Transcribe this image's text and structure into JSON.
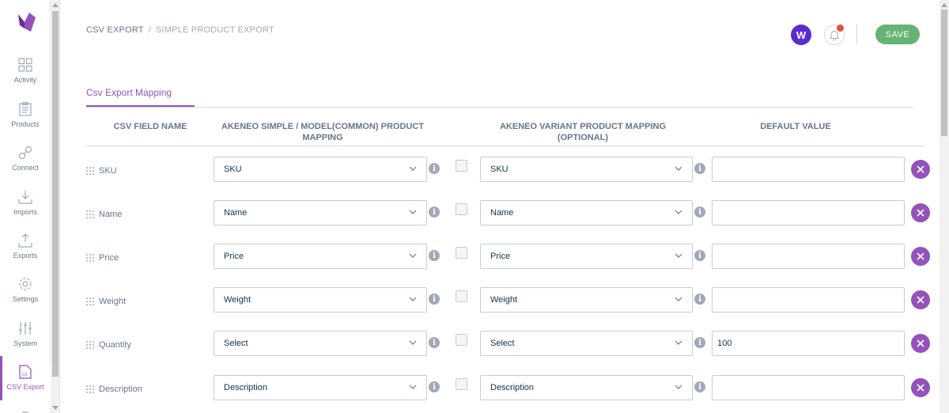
{
  "nav": {
    "items": [
      {
        "label": "Activity",
        "icon": "dashboard-grid-icon"
      },
      {
        "label": "Products",
        "icon": "clipboard-icon"
      },
      {
        "label": "Connect",
        "icon": "connect-icon"
      },
      {
        "label": "Imports",
        "icon": "import-icon"
      },
      {
        "label": "Exports",
        "icon": "export-icon"
      },
      {
        "label": "Settings",
        "icon": "gear-icon"
      },
      {
        "label": "System",
        "icon": "sliders-icon"
      },
      {
        "label": "CSV Export",
        "icon": "csv-file-icon"
      }
    ],
    "active": "CSV Export",
    "accent": "#9452ba"
  },
  "header": {
    "breadcrumb": {
      "root": "CSV EXPORT",
      "separator": "/",
      "current": "SIMPLE PRODUCT EXPORT"
    },
    "avatar_letter": "W",
    "save_label": "SAVE",
    "save_color": "#67b373"
  },
  "tabs": [
    {
      "label": "Csv Export Mapping",
      "active": true
    }
  ],
  "table": {
    "headers": {
      "field": "CSV FIELD NAME",
      "simple": "AKENEO SIMPLE / MODEL(COMMON) PRODUCT MAPPING",
      "variant": "AKENEO VARIANT PRODUCT MAPPING (OPTIONAL)",
      "default": "DEFAULT VALUE"
    },
    "rows": [
      {
        "field": "SKU",
        "simple": "SKU",
        "variant": "SKU",
        "default": ""
      },
      {
        "field": "Name",
        "simple": "Name",
        "variant": "Name",
        "default": ""
      },
      {
        "field": "Price",
        "simple": "Price",
        "variant": "Price",
        "default": ""
      },
      {
        "field": "Weight",
        "simple": "Weight",
        "variant": "Weight",
        "default": ""
      },
      {
        "field": "Quantity",
        "simple": "Select",
        "variant": "Select",
        "default": "100"
      },
      {
        "field": "Description",
        "simple": "Description",
        "variant": "Description",
        "default": ""
      }
    ]
  }
}
